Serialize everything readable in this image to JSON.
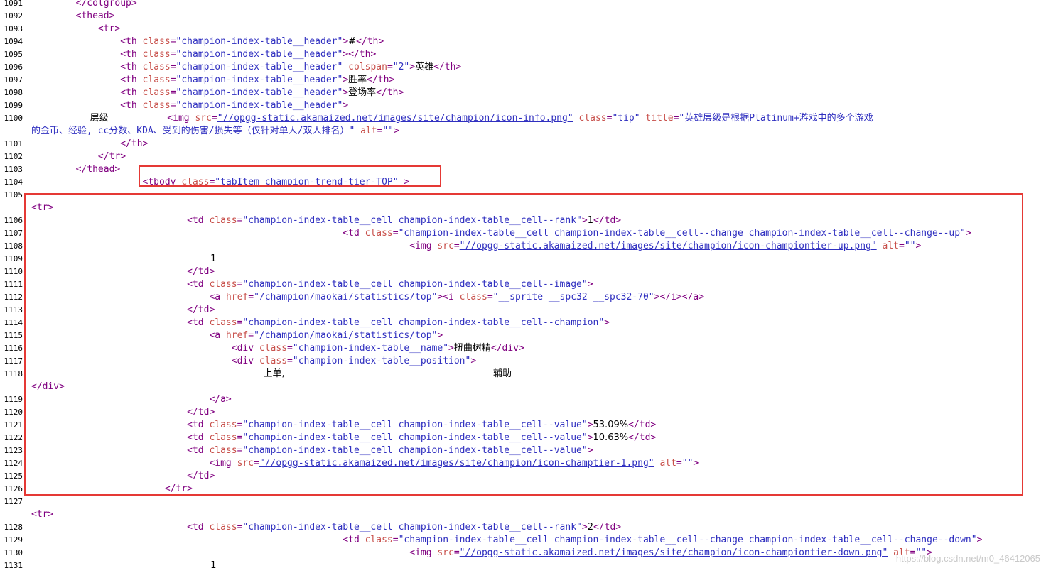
{
  "viewer": {
    "lines": [
      {
        "n": "1091",
        "segs": [
          [
            "tag",
            "        </colgroup>"
          ]
        ]
      },
      {
        "n": "1092",
        "segs": [
          [
            "tag",
            "        <thead>"
          ]
        ]
      },
      {
        "n": "1093",
        "segs": [
          [
            "tag",
            "            <tr>"
          ]
        ]
      },
      {
        "n": "1094",
        "segs": [
          [
            "tag",
            "                <th "
          ],
          [
            "attr",
            "class"
          ],
          [
            "tag",
            "="
          ],
          [
            "val",
            "\"champion-index-table__header\""
          ],
          [
            "tag",
            ">"
          ],
          [
            "txt",
            "#"
          ],
          [
            "tag",
            "</th>"
          ]
        ]
      },
      {
        "n": "1095",
        "segs": [
          [
            "tag",
            "                <th "
          ],
          [
            "attr",
            "class"
          ],
          [
            "tag",
            "="
          ],
          [
            "val",
            "\"champion-index-table__header\""
          ],
          [
            "tag",
            "></th>"
          ]
        ]
      },
      {
        "n": "1096",
        "segs": [
          [
            "tag",
            "                <th "
          ],
          [
            "attr",
            "class"
          ],
          [
            "tag",
            "="
          ],
          [
            "val",
            "\"champion-index-table__header\""
          ],
          [
            "tag",
            " "
          ],
          [
            "attr",
            "colspan"
          ],
          [
            "tag",
            "="
          ],
          [
            "val",
            "\"2\""
          ],
          [
            "tag",
            ">"
          ],
          [
            "txt",
            "英雄"
          ],
          [
            "tag",
            "</th>"
          ]
        ]
      },
      {
        "n": "1097",
        "segs": [
          [
            "tag",
            "                <th "
          ],
          [
            "attr",
            "class"
          ],
          [
            "tag",
            "="
          ],
          [
            "val",
            "\"champion-index-table__header\""
          ],
          [
            "tag",
            ">"
          ],
          [
            "txt",
            "胜率"
          ],
          [
            "tag",
            "</th>"
          ]
        ]
      },
      {
        "n": "1098",
        "segs": [
          [
            "tag",
            "                <th "
          ],
          [
            "attr",
            "class"
          ],
          [
            "tag",
            "="
          ],
          [
            "val",
            "\"champion-index-table__header\""
          ],
          [
            "tag",
            ">"
          ],
          [
            "txt",
            "登场率"
          ],
          [
            "tag",
            "</th>"
          ]
        ]
      },
      {
        "n": "1099",
        "segs": [
          [
            "tag",
            "                <th "
          ],
          [
            "attr",
            "class"
          ],
          [
            "tag",
            "="
          ],
          [
            "val",
            "\"champion-index-table__header\""
          ],
          [
            "tag",
            ">"
          ]
        ]
      },
      {
        "n": "1100",
        "segs": [
          [
            "txt",
            "                    层级                    "
          ],
          [
            "tag",
            "<img "
          ],
          [
            "attr",
            "src"
          ],
          [
            "tag",
            "="
          ],
          [
            "link",
            "\"//opgg-static.akamaized.net/images/site/champion/icon-info.png\""
          ],
          [
            "tag",
            " "
          ],
          [
            "attr",
            "class"
          ],
          [
            "tag",
            "="
          ],
          [
            "val",
            "\"tip\""
          ],
          [
            "tag",
            " "
          ],
          [
            "attr",
            "title"
          ],
          [
            "tag",
            "="
          ],
          [
            "val",
            "\"英雄层级是根据Platinum+游戏中的多个游戏"
          ]
        ]
      },
      {
        "n": "",
        "segs": [
          [
            "val",
            "的金币、经验, cc分数、KDA、受到的伤害/损失等（仅针对单人/双人排名）\""
          ],
          [
            "tag",
            " "
          ],
          [
            "attr",
            "alt"
          ],
          [
            "tag",
            "="
          ],
          [
            "val",
            "\"\""
          ],
          [
            "tag",
            ">"
          ]
        ]
      },
      {
        "n": "1101",
        "segs": [
          [
            "tag",
            "                </th>"
          ]
        ]
      },
      {
        "n": "1102",
        "segs": [
          [
            "tag",
            "            </tr>"
          ]
        ]
      },
      {
        "n": "1103",
        "segs": [
          [
            "tag",
            "        </thead>"
          ]
        ]
      },
      {
        "n": "1104",
        "segs": [
          [
            "tag",
            "                    <tbody "
          ],
          [
            "attr",
            "class"
          ],
          [
            "tag",
            "="
          ],
          [
            "val",
            "\"tabItem champion-trend-tier-TOP\""
          ],
          [
            "tag",
            " >"
          ]
        ]
      },
      {
        "n": "1105",
        "segs": []
      },
      {
        "n": "",
        "segs": [
          [
            "tag",
            "<tr>"
          ]
        ]
      },
      {
        "n": "1106",
        "segs": [
          [
            "tag",
            "                            <td "
          ],
          [
            "attr",
            "class"
          ],
          [
            "tag",
            "="
          ],
          [
            "val",
            "\"champion-index-table__cell champion-index-table__cell--rank\""
          ],
          [
            "tag",
            ">"
          ],
          [
            "txt",
            "1"
          ],
          [
            "tag",
            "</td>"
          ]
        ]
      },
      {
        "n": "1107",
        "segs": [
          [
            "tag",
            "                                                        <td "
          ],
          [
            "attr",
            "class"
          ],
          [
            "tag",
            "="
          ],
          [
            "val",
            "\"champion-index-table__cell champion-index-table__cell--change champion-index-table__cell--change--up\""
          ],
          [
            "tag",
            ">"
          ]
        ]
      },
      {
        "n": "1108",
        "segs": [
          [
            "tag",
            "                                                                    <img "
          ],
          [
            "attr",
            "src"
          ],
          [
            "tag",
            "="
          ],
          [
            "link",
            "\"//opgg-static.akamaized.net/images/site/champion/icon-championtier-up.png\""
          ],
          [
            "tag",
            " "
          ],
          [
            "attr",
            "alt"
          ],
          [
            "tag",
            "="
          ],
          [
            "val",
            "\"\""
          ],
          [
            "tag",
            ">"
          ]
        ]
      },
      {
        "n": "1109",
        "segs": [
          [
            "txt",
            "                                                             1"
          ]
        ]
      },
      {
        "n": "1110",
        "segs": [
          [
            "tag",
            "                            </td>"
          ]
        ]
      },
      {
        "n": "1111",
        "segs": [
          [
            "tag",
            "                            <td "
          ],
          [
            "attr",
            "class"
          ],
          [
            "tag",
            "="
          ],
          [
            "val",
            "\"champion-index-table__cell champion-index-table__cell--image\""
          ],
          [
            "tag",
            ">"
          ]
        ]
      },
      {
        "n": "1112",
        "segs": [
          [
            "tag",
            "                                <a "
          ],
          [
            "attr",
            "href"
          ],
          [
            "tag",
            "="
          ],
          [
            "val",
            "\"/champion/maokai/statistics/top\""
          ],
          [
            "tag",
            "><i "
          ],
          [
            "attr",
            "class"
          ],
          [
            "tag",
            "="
          ],
          [
            "val",
            "\"__sprite __spc32 __spc32-70\""
          ],
          [
            "tag",
            "></i></a>"
          ]
        ]
      },
      {
        "n": "1113",
        "segs": [
          [
            "tag",
            "                            </td>"
          ]
        ]
      },
      {
        "n": "1114",
        "segs": [
          [
            "tag",
            "                            <td "
          ],
          [
            "attr",
            "class"
          ],
          [
            "tag",
            "="
          ],
          [
            "val",
            "\"champion-index-table__cell champion-index-table__cell--champion\""
          ],
          [
            "tag",
            ">"
          ]
        ]
      },
      {
        "n": "1115",
        "segs": [
          [
            "tag",
            "                                <a "
          ],
          [
            "attr",
            "href"
          ],
          [
            "tag",
            "="
          ],
          [
            "val",
            "\"/champion/maokai/statistics/top\""
          ],
          [
            "tag",
            ">"
          ]
        ]
      },
      {
        "n": "1116",
        "segs": [
          [
            "tag",
            "                                    <div "
          ],
          [
            "attr",
            "class"
          ],
          [
            "tag",
            "="
          ],
          [
            "val",
            "\"champion-index-table__name\""
          ],
          [
            "tag",
            ">"
          ],
          [
            "txt",
            "扭曲树精"
          ],
          [
            "tag",
            "</div>"
          ]
        ]
      },
      {
        "n": "1117",
        "segs": [
          [
            "tag",
            "                                    <div "
          ],
          [
            "attr",
            "class"
          ],
          [
            "tag",
            "="
          ],
          [
            "val",
            "\"champion-index-table__position\""
          ],
          [
            "tag",
            ">"
          ]
        ]
      },
      {
        "n": "1118",
        "segs": [
          [
            "txt",
            "                                                                               上单,                                                                       辅助"
          ]
        ]
      },
      {
        "n": "",
        "segs": [
          [
            "tag",
            "</div>"
          ]
        ]
      },
      {
        "n": "1119",
        "segs": [
          [
            "tag",
            "                                </a>"
          ]
        ]
      },
      {
        "n": "1120",
        "segs": [
          [
            "tag",
            "                            </td>"
          ]
        ]
      },
      {
        "n": "1121",
        "segs": [
          [
            "tag",
            "                            <td "
          ],
          [
            "attr",
            "class"
          ],
          [
            "tag",
            "="
          ],
          [
            "val",
            "\"champion-index-table__cell champion-index-table__cell--value\""
          ],
          [
            "tag",
            ">"
          ],
          [
            "txt",
            "53.09%"
          ],
          [
            "tag",
            "</td>"
          ]
        ]
      },
      {
        "n": "1122",
        "segs": [
          [
            "tag",
            "                            <td "
          ],
          [
            "attr",
            "class"
          ],
          [
            "tag",
            "="
          ],
          [
            "val",
            "\"champion-index-table__cell champion-index-table__cell--value\""
          ],
          [
            "tag",
            ">"
          ],
          [
            "txt",
            "10.63%"
          ],
          [
            "tag",
            "</td>"
          ]
        ]
      },
      {
        "n": "1123",
        "segs": [
          [
            "tag",
            "                            <td "
          ],
          [
            "attr",
            "class"
          ],
          [
            "tag",
            "="
          ],
          [
            "val",
            "\"champion-index-table__cell champion-index-table__cell--value\""
          ],
          [
            "tag",
            ">"
          ]
        ]
      },
      {
        "n": "1124",
        "segs": [
          [
            "tag",
            "                                <img "
          ],
          [
            "attr",
            "src"
          ],
          [
            "tag",
            "="
          ],
          [
            "link",
            "\"//opgg-static.akamaized.net/images/site/champion/icon-champtier-1.png\""
          ],
          [
            "tag",
            " "
          ],
          [
            "attr",
            "alt"
          ],
          [
            "tag",
            "="
          ],
          [
            "val",
            "\"\""
          ],
          [
            "tag",
            ">"
          ]
        ]
      },
      {
        "n": "1125",
        "segs": [
          [
            "tag",
            "                            </td>"
          ]
        ]
      },
      {
        "n": "1126",
        "segs": [
          [
            "tag",
            "                        </tr>"
          ]
        ]
      },
      {
        "n": "1127",
        "segs": []
      },
      {
        "n": "",
        "segs": [
          [
            "tag",
            "<tr>"
          ]
        ]
      },
      {
        "n": "1128",
        "segs": [
          [
            "tag",
            "                            <td "
          ],
          [
            "attr",
            "class"
          ],
          [
            "tag",
            "="
          ],
          [
            "val",
            "\"champion-index-table__cell champion-index-table__cell--rank\""
          ],
          [
            "tag",
            ">"
          ],
          [
            "txt",
            "2"
          ],
          [
            "tag",
            "</td>"
          ]
        ]
      },
      {
        "n": "1129",
        "segs": [
          [
            "tag",
            "                                                        <td "
          ],
          [
            "attr",
            "class"
          ],
          [
            "tag",
            "="
          ],
          [
            "val",
            "\"champion-index-table__cell champion-index-table__cell--change champion-index-table__cell--change--down\""
          ],
          [
            "tag",
            ">"
          ]
        ]
      },
      {
        "n": "1130",
        "segs": [
          [
            "tag",
            "                                                                    <img "
          ],
          [
            "attr",
            "src"
          ],
          [
            "tag",
            "="
          ],
          [
            "link",
            "\"//opgg-static.akamaized.net/images/site/champion/icon-championtier-down.png\""
          ],
          [
            "tag",
            " "
          ],
          [
            "attr",
            "alt"
          ],
          [
            "tag",
            "="
          ],
          [
            "val",
            "\"\""
          ],
          [
            "tag",
            ">"
          ]
        ]
      },
      {
        "n": "1131",
        "segs": [
          [
            "txt",
            "                                                             1"
          ]
        ]
      }
    ]
  },
  "watermark": "https://blog.csdn.net/m0_46412065",
  "colors": {
    "tag": "#800080",
    "attribute": "#c8504b",
    "value": "#3030c0",
    "highlight_box": "#e53935"
  }
}
